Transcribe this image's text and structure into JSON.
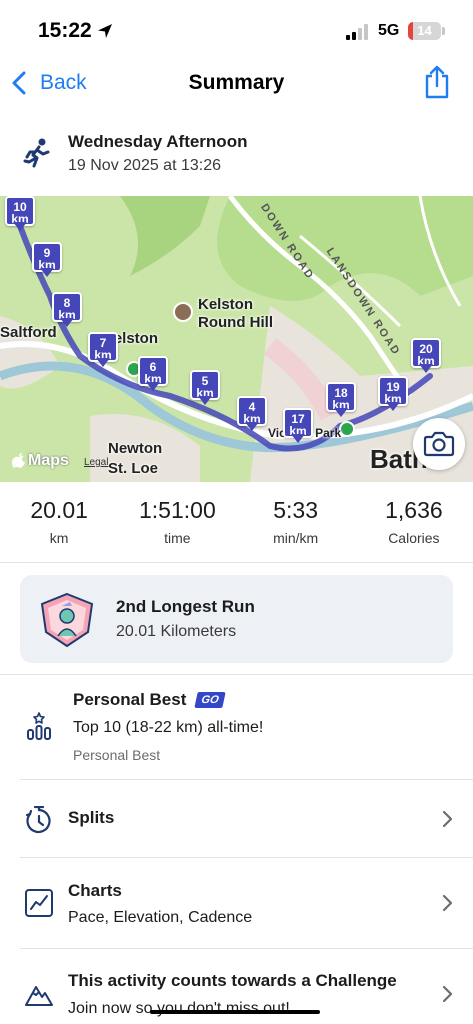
{
  "status_bar": {
    "time": "15:22",
    "network": "5G",
    "battery": "14",
    "battery_level": 0.14
  },
  "nav": {
    "back_label": "Back",
    "title": "Summary"
  },
  "activity": {
    "title": "Wednesday Afternoon",
    "date": "19 Nov 2025 at 13:26"
  },
  "map": {
    "place_labels": [
      "Saltford",
      "Kelston",
      "Round Hill",
      "Kelston",
      "Newton",
      "St. Loe",
      "Bath",
      "Victoria Park"
    ],
    "road_labels": [
      "DOWN ROAD",
      "LANSDOWN ROAD"
    ],
    "brand": "Maps",
    "legal": "Legal",
    "km_markers": [
      {
        "num": "10",
        "unit": "km"
      },
      {
        "num": "9",
        "unit": "km"
      },
      {
        "num": "8",
        "unit": "km"
      },
      {
        "num": "7",
        "unit": "km"
      },
      {
        "num": "6",
        "unit": "km"
      },
      {
        "num": "5",
        "unit": "km"
      },
      {
        "num": "4",
        "unit": "km"
      },
      {
        "num": "17",
        "unit": "km"
      },
      {
        "num": "18",
        "unit": "km"
      },
      {
        "num": "19",
        "unit": "km"
      },
      {
        "num": "20",
        "unit": "km"
      }
    ],
    "route_color": "#4546b8"
  },
  "stats": [
    {
      "value": "20.01",
      "label": "km"
    },
    {
      "value": "1:51:00",
      "label": "time"
    },
    {
      "value": "5:33",
      "label": "min/km"
    },
    {
      "value": "1,636",
      "label": "Calories"
    }
  ],
  "achievement": {
    "title": "2nd Longest Run",
    "subtitle": "20.01 Kilometers"
  },
  "personal_best": {
    "title": "Personal Best",
    "badge": "GO",
    "detail": "Top 10 (18-22 km) all-time!",
    "caption": "Personal Best"
  },
  "splits": {
    "title": "Splits"
  },
  "charts": {
    "title": "Charts",
    "subtitle": "Pace, Elevation, Cadence"
  },
  "challenge": {
    "title": "This activity counts towards a Challenge",
    "subtitle": "Join now so you don't miss out!"
  },
  "colors": {
    "accent": "#1e7df2",
    "icon_navy": "#1f3a6e",
    "card_bg": "#edf0f4"
  }
}
